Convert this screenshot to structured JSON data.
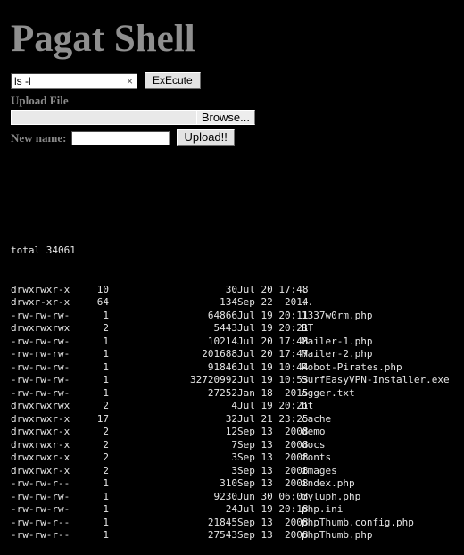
{
  "title": "Pagat Shell",
  "command_form": {
    "input_value": "ls -l",
    "input_placeholder": "",
    "clear_icon": "×",
    "execute_label": "ExEcute"
  },
  "upload": {
    "section_label": "Upload File",
    "file_value": "",
    "browse_label": "Browse...",
    "newname_label": "New name:",
    "newname_value": "",
    "newname_placeholder": "",
    "upload_label": "Upload!!"
  },
  "listing": {
    "totals": "total 34061",
    "rows": [
      {
        "perm": "drwxrwxr-x",
        "links": "10",
        "owner": "",
        "size": "30",
        "date": "Jul 20 17:48",
        "name": "."
      },
      {
        "perm": "drwxr-xr-x",
        "links": "64",
        "owner": "",
        "size": "134",
        "date": "Sep 22  2014",
        "name": ".."
      },
      {
        "perm": "-rw-rw-rw-",
        "links": "1",
        "owner": "",
        "size": "64866",
        "date": "Jul 19 20:11",
        "name": "1337w0rm.php"
      },
      {
        "perm": "drwxrwxrwx",
        "links": "2",
        "owner": "",
        "size": "5443",
        "date": "Jul 19 20:21",
        "name": "BT"
      },
      {
        "perm": "-rw-rw-rw-",
        "links": "1",
        "owner": "",
        "size": "10214",
        "date": "Jul 20 17:48",
        "name": "Mailer-1.php"
      },
      {
        "perm": "-rw-rw-rw-",
        "links": "1",
        "owner": "",
        "size": "201688",
        "date": "Jul 20 17:47",
        "name": "Mailer-2.php"
      },
      {
        "perm": "-rw-rw-rw-",
        "links": "1",
        "owner": "",
        "size": "91846",
        "date": "Jul 19 10:44",
        "name": "Robot-Pirates.php"
      },
      {
        "perm": "-rw-rw-rw-",
        "links": "1",
        "owner": "",
        "size": "32720992",
        "date": "Jul 19 10:53",
        "name": "SurfEasyVPN-Installer.exe"
      },
      {
        "perm": "-rw-rw-rw-",
        "links": "1",
        "owner": "",
        "size": "27252",
        "date": "Jan 18  2015",
        "name": "agger.txt"
      },
      {
        "perm": "drwxrwxrwx",
        "links": "2",
        "owner": "",
        "size": "4",
        "date": "Jul 19 20:21",
        "name": "bt"
      },
      {
        "perm": "drwxrwxr-x",
        "links": "17",
        "owner": "",
        "size": "32",
        "date": "Jul 21 23:25",
        "name": "cache"
      },
      {
        "perm": "drwxrwxr-x",
        "links": "2",
        "owner": "",
        "size": "12",
        "date": "Sep 13  2008",
        "name": "demo"
      },
      {
        "perm": "drwxrwxr-x",
        "links": "2",
        "owner": "",
        "size": "7",
        "date": "Sep 13  2008",
        "name": "docs"
      },
      {
        "perm": "drwxrwxr-x",
        "links": "2",
        "owner": "",
        "size": "3",
        "date": "Sep 13  2008",
        "name": "fonts"
      },
      {
        "perm": "drwxrwxr-x",
        "links": "2",
        "owner": "",
        "size": "3",
        "date": "Sep 13  2008",
        "name": "images"
      },
      {
        "perm": "-rw-rw-r--",
        "links": "1",
        "owner": "",
        "size": "310",
        "date": "Sep 13  2008",
        "name": "index.php"
      },
      {
        "perm": "-rw-rw-rw-",
        "links": "1",
        "owner": "",
        "size": "9230",
        "date": "Jun 30 06:03",
        "name": "myluph.php"
      },
      {
        "perm": "-rw-rw-rw-",
        "links": "1",
        "owner": "",
        "size": "24",
        "date": "Jul 19 20:18",
        "name": "php.ini"
      },
      {
        "perm": "-rw-rw-r--",
        "links": "1",
        "owner": "",
        "size": "21845",
        "date": "Sep 13  2008",
        "name": "phpThumb.config.php"
      },
      {
        "perm": "-rw-rw-r--",
        "links": "1",
        "owner": "",
        "size": "27543",
        "date": "Sep 13  2008",
        "name": "phpThumb.php"
      }
    ]
  },
  "colors": {
    "background": "#000000",
    "title": "#8f8f8f",
    "label": "#8a8a8a",
    "terminal_text": "#e6e6e6",
    "button_face": "#e3e3e3"
  }
}
